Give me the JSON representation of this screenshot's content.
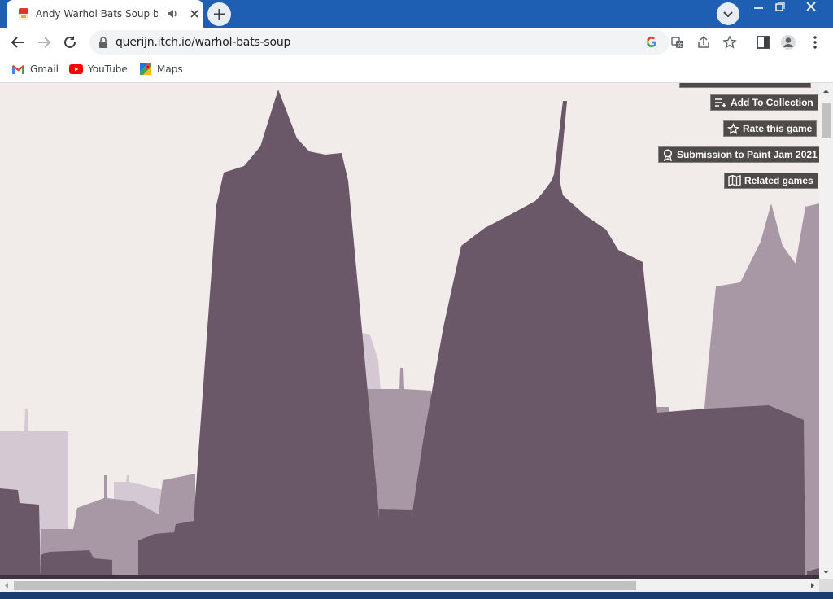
{
  "browser": {
    "tab": {
      "title": "Andy Warhol Bats Soup by Q",
      "close_glyph": "✕"
    },
    "new_tab_glyph": "+",
    "url": "querijn.itch.io/warhol-bats-soup",
    "bookmarks": [
      {
        "label": "Gmail",
        "icon": "gmail-icon"
      },
      {
        "label": "YouTube",
        "icon": "youtube-icon"
      },
      {
        "label": "Maps",
        "icon": "maps-icon"
      }
    ]
  },
  "itch": {
    "buttons": [
      {
        "label": "Add To Collection",
        "icon": "add-to-collection-icon"
      },
      {
        "label": "Rate this game",
        "icon": "star-icon"
      },
      {
        "label": "Submission to Paint Jam 2021",
        "icon": "award-icon"
      },
      {
        "label": "Related games",
        "icon": "map-icon"
      }
    ]
  },
  "colors": {
    "tabstrip": "#1f5fb3",
    "sky": "#f1ecea",
    "building_dark": "#6a5868",
    "building_mid": "#a898a6",
    "building_light": "#d4c8d2",
    "itch_button": "#4f4b4b"
  }
}
